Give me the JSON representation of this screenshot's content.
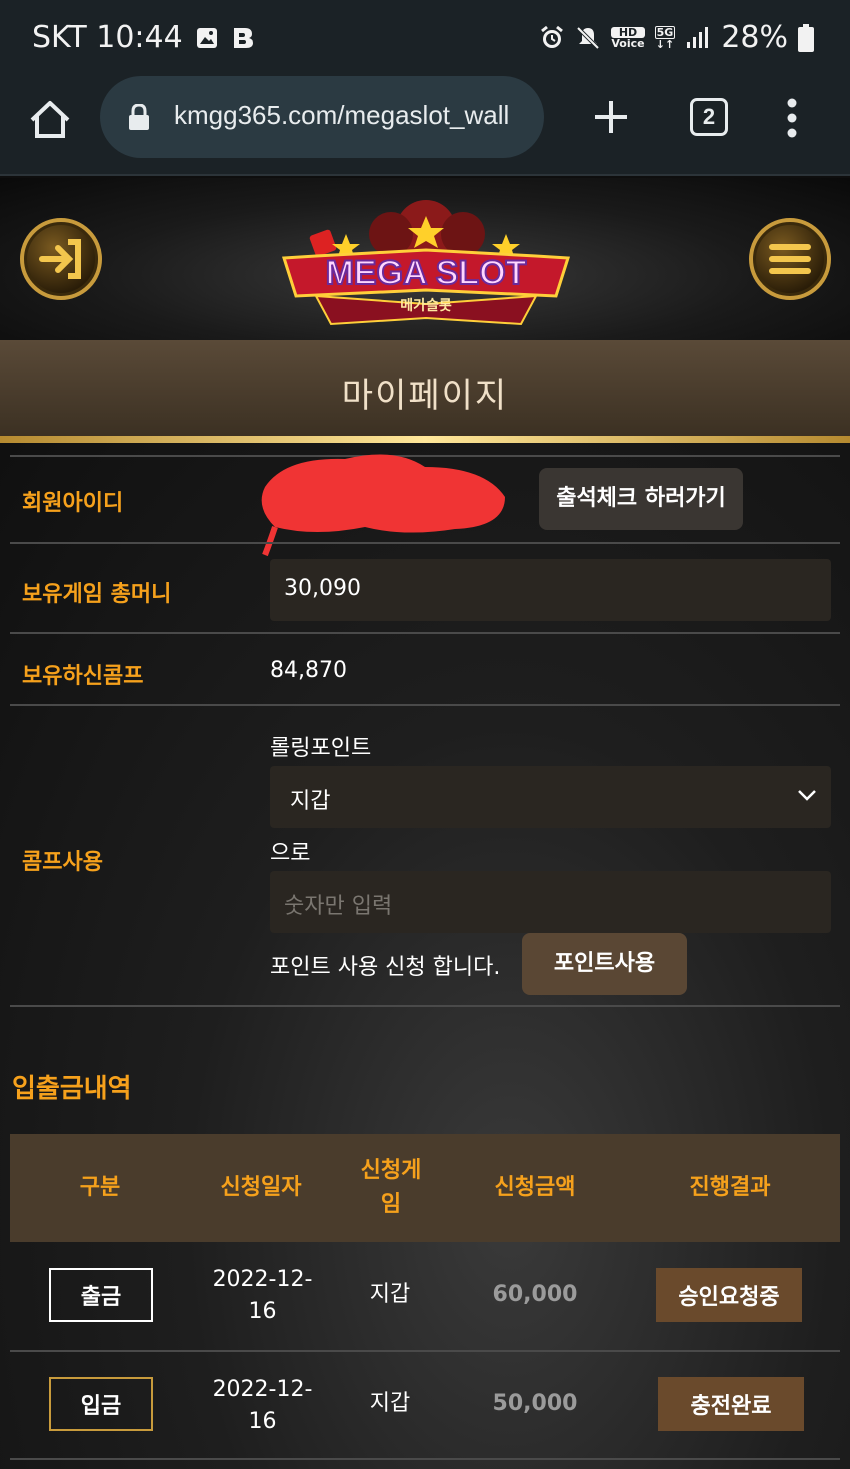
{
  "status_bar": {
    "carrier_time": "SKT 10:44",
    "hd_label": "HD",
    "voice_label": "Voice",
    "net_label": "5G",
    "battery": "28%"
  },
  "browser": {
    "url": "kmgg365.com/megaslot_wall",
    "tab_count": "2"
  },
  "site": {
    "logo_text": "MEGA SLOT",
    "logo_subtext": "메가슬롯"
  },
  "page_title": "마이페이지",
  "profile": {
    "member_id_label": "회원아이디",
    "attendance_button": "출석체크 하러가기",
    "game_money_label": "보유게임 총머니",
    "game_money_value": "30,090",
    "comp_label": "보유하신콤프",
    "comp_value": "84,870",
    "comp_use_label": "콤프사용",
    "rolling_point_label": "롤링포인트",
    "wallet_select_value": "지갑",
    "to_label": "으로",
    "amount_placeholder": "숫자만 입력",
    "apply_text": "포인트 사용 신청 합니다.",
    "use_point_button": "포인트사용"
  },
  "history": {
    "title": "입출금내역",
    "headers": [
      "구분",
      "신청일자",
      "신청게\n임",
      "신청금액",
      "진행결과"
    ],
    "rows": [
      {
        "type": "출금",
        "date": "2022-12-\n16",
        "game": "지갑",
        "amount": "60,000",
        "status": "승인요청중"
      },
      {
        "type": "입금",
        "date": "2022-12-\n16",
        "game": "지갑",
        "amount": "50,000",
        "status": "충전완료"
      }
    ]
  }
}
